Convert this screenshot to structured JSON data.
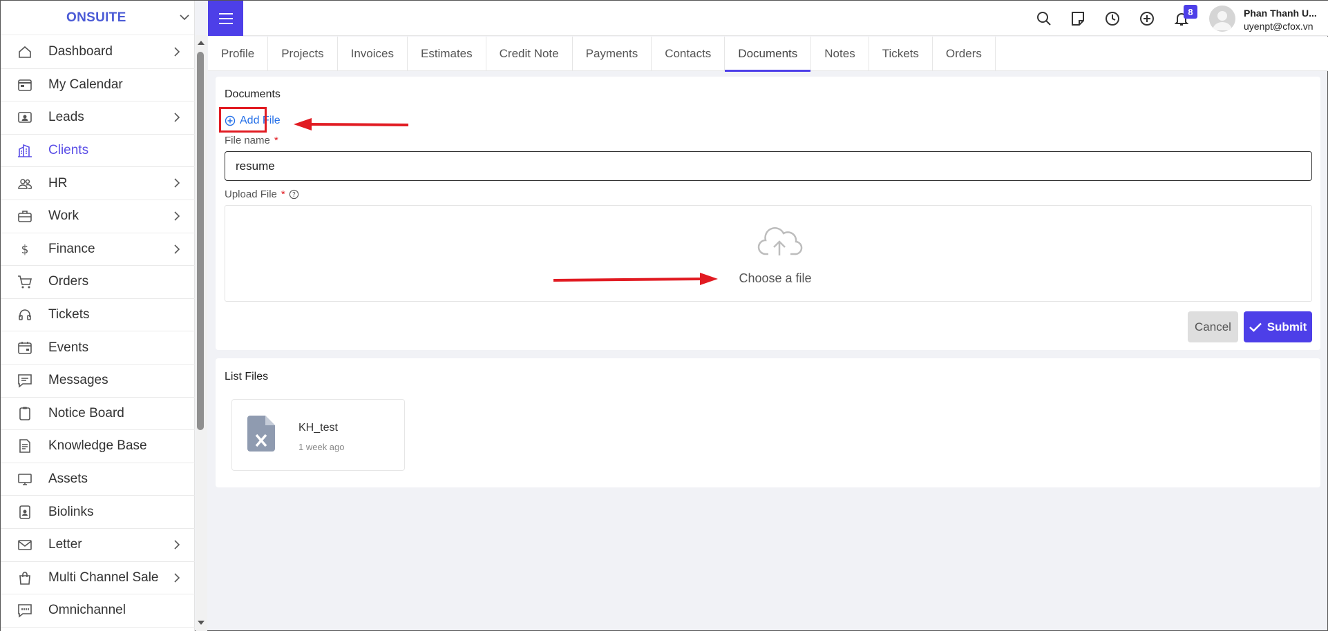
{
  "brand": {
    "name": "ONSUITE"
  },
  "sidebar": {
    "items": [
      {
        "label": "Dashboard",
        "icon": "home-icon",
        "chevron": true,
        "active": false
      },
      {
        "label": "My Calendar",
        "icon": "calendar-icon",
        "chevron": false,
        "active": false
      },
      {
        "label": "Leads",
        "icon": "contact-card-icon",
        "chevron": true,
        "active": false
      },
      {
        "label": "Clients",
        "icon": "building-icon",
        "chevron": false,
        "active": true
      },
      {
        "label": "HR",
        "icon": "people-icon",
        "chevron": true,
        "active": false
      },
      {
        "label": "Work",
        "icon": "briefcase-icon",
        "chevron": true,
        "active": false
      },
      {
        "label": "Finance",
        "icon": "dollar-icon",
        "chevron": true,
        "active": false
      },
      {
        "label": "Orders",
        "icon": "cart-icon",
        "chevron": false,
        "active": false
      },
      {
        "label": "Tickets",
        "icon": "headset-icon",
        "chevron": false,
        "active": false
      },
      {
        "label": "Events",
        "icon": "calendar-event-icon",
        "chevron": false,
        "active": false
      },
      {
        "label": "Messages",
        "icon": "message-icon",
        "chevron": false,
        "active": false
      },
      {
        "label": "Notice Board",
        "icon": "clipboard-icon",
        "chevron": false,
        "active": false
      },
      {
        "label": "Knowledge Base",
        "icon": "document-icon",
        "chevron": false,
        "active": false
      },
      {
        "label": "Assets",
        "icon": "monitor-icon",
        "chevron": false,
        "active": false
      },
      {
        "label": "Biolinks",
        "icon": "id-badge-icon",
        "chevron": false,
        "active": false
      },
      {
        "label": "Letter",
        "icon": "envelope-icon",
        "chevron": true,
        "active": false
      },
      {
        "label": "Multi Channel Sale",
        "icon": "shopping-bag-icon",
        "chevron": true,
        "active": false
      },
      {
        "label": "Omnichannel",
        "icon": "chat-quote-icon",
        "chevron": false,
        "active": false
      }
    ]
  },
  "topbar": {
    "notification_count": "8",
    "user_name": "Phan Thanh U...",
    "user_email": "uyenpt@cfox.vn"
  },
  "tabs": [
    {
      "label": "Profile",
      "active": false
    },
    {
      "label": "Projects",
      "active": false
    },
    {
      "label": "Invoices",
      "active": false
    },
    {
      "label": "Estimates",
      "active": false
    },
    {
      "label": "Credit Note",
      "active": false
    },
    {
      "label": "Payments",
      "active": false
    },
    {
      "label": "Contacts",
      "active": false
    },
    {
      "label": "Documents",
      "active": true
    },
    {
      "label": "Notes",
      "active": false
    },
    {
      "label": "Tickets",
      "active": false
    },
    {
      "label": "Orders",
      "active": false
    }
  ],
  "documents": {
    "title": "Documents",
    "add_file_label": "Add File",
    "file_name_label": "File name",
    "required_mark": "*",
    "file_name_value": "resume",
    "upload_label": "Upload File",
    "upload_prompt": "Choose a file",
    "cancel_label": "Cancel",
    "submit_label": "Submit"
  },
  "list_files": {
    "title": "List Files",
    "files": [
      {
        "name": "KH_test",
        "time": "1 week ago"
      }
    ]
  },
  "colors": {
    "accent": "#4d3fe8",
    "link": "#2570e8",
    "annotation": "#e11b22"
  }
}
